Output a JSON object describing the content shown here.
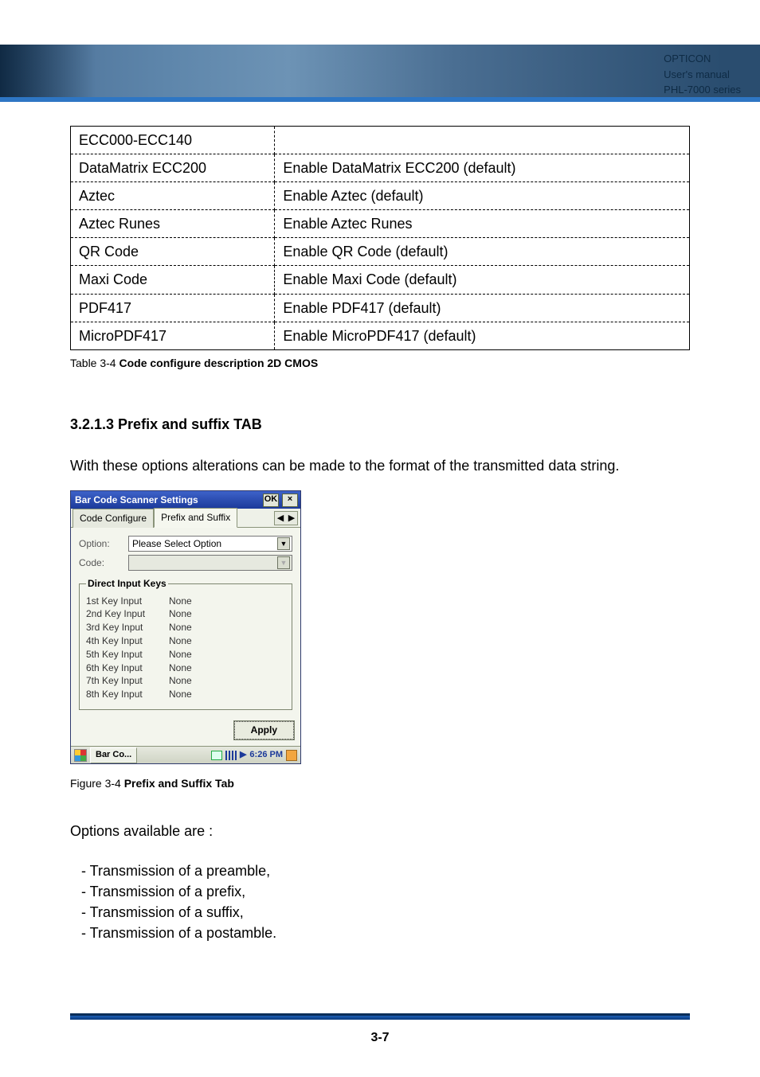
{
  "header": {
    "brand": "OPTICON",
    "line2": "User's manual",
    "line3": "PHL-7000 series"
  },
  "table_rows": [
    {
      "left": "ECC000-ECC140",
      "right": ""
    },
    {
      "left": "DataMatrix ECC200",
      "right": "Enable DataMatrix ECC200 (default)"
    },
    {
      "left": "Aztec",
      "right": "Enable Aztec (default)"
    },
    {
      "left": "Aztec Runes",
      "right": "Enable Aztec Runes"
    },
    {
      "left": "QR Code",
      "right": "Enable QR Code (default)"
    },
    {
      "left": "Maxi Code",
      "right": "Enable Maxi Code (default)"
    },
    {
      "left": "PDF417",
      "right": "Enable PDF417 (default)"
    },
    {
      "left": "MicroPDF417",
      "right": "Enable MicroPDF417 (default)"
    }
  ],
  "table_caption_prefix": "Table 3-4 ",
  "table_caption_bold": "Code configure description 2D CMOS",
  "section_heading": "3.2.1.3 Prefix and suffix TAB",
  "section_intro": "With these options alterations can be made to the format of the transmitted data string.",
  "wince": {
    "title": "Bar Code Scanner Settings",
    "ok_label": "OK",
    "close_label": "×",
    "tabs": {
      "left": "Code Configure",
      "active": "Prefix and Suffix",
      "scroll_left": "◀",
      "scroll_right": "▶"
    },
    "option_label": "Option:",
    "option_value": "Please Select Option",
    "code_label": "Code:",
    "code_value": "",
    "direct_legend": "Direct Input Keys",
    "key_rows": [
      {
        "k": "1st  Key Input",
        "v": "None"
      },
      {
        "k": "2nd Key Input",
        "v": "None"
      },
      {
        "k": "3rd Key Input",
        "v": "None"
      },
      {
        "k": "4th Key Input",
        "v": "None"
      },
      {
        "k": "5th Key Input",
        "v": "None"
      },
      {
        "k": "6th Key Input",
        "v": "None"
      },
      {
        "k": "7th Key Input",
        "v": "None"
      },
      {
        "k": "8th Key Input",
        "v": "None"
      }
    ],
    "apply_label": "Apply",
    "taskbar_task": "Bar Co...",
    "taskbar_clock": "6:26 PM",
    "taskbar_arrow": "▶"
  },
  "figure_caption_prefix": "Figure 3-4 ",
  "figure_caption_bold": "Prefix and Suffix Tab",
  "options_intro": "Options available are :",
  "options": [
    "Transmission of a preamble,",
    "Transmission of a prefix,",
    "Transmission of a suffix,",
    "Transmission of a postamble."
  ],
  "page_number": "3-7"
}
